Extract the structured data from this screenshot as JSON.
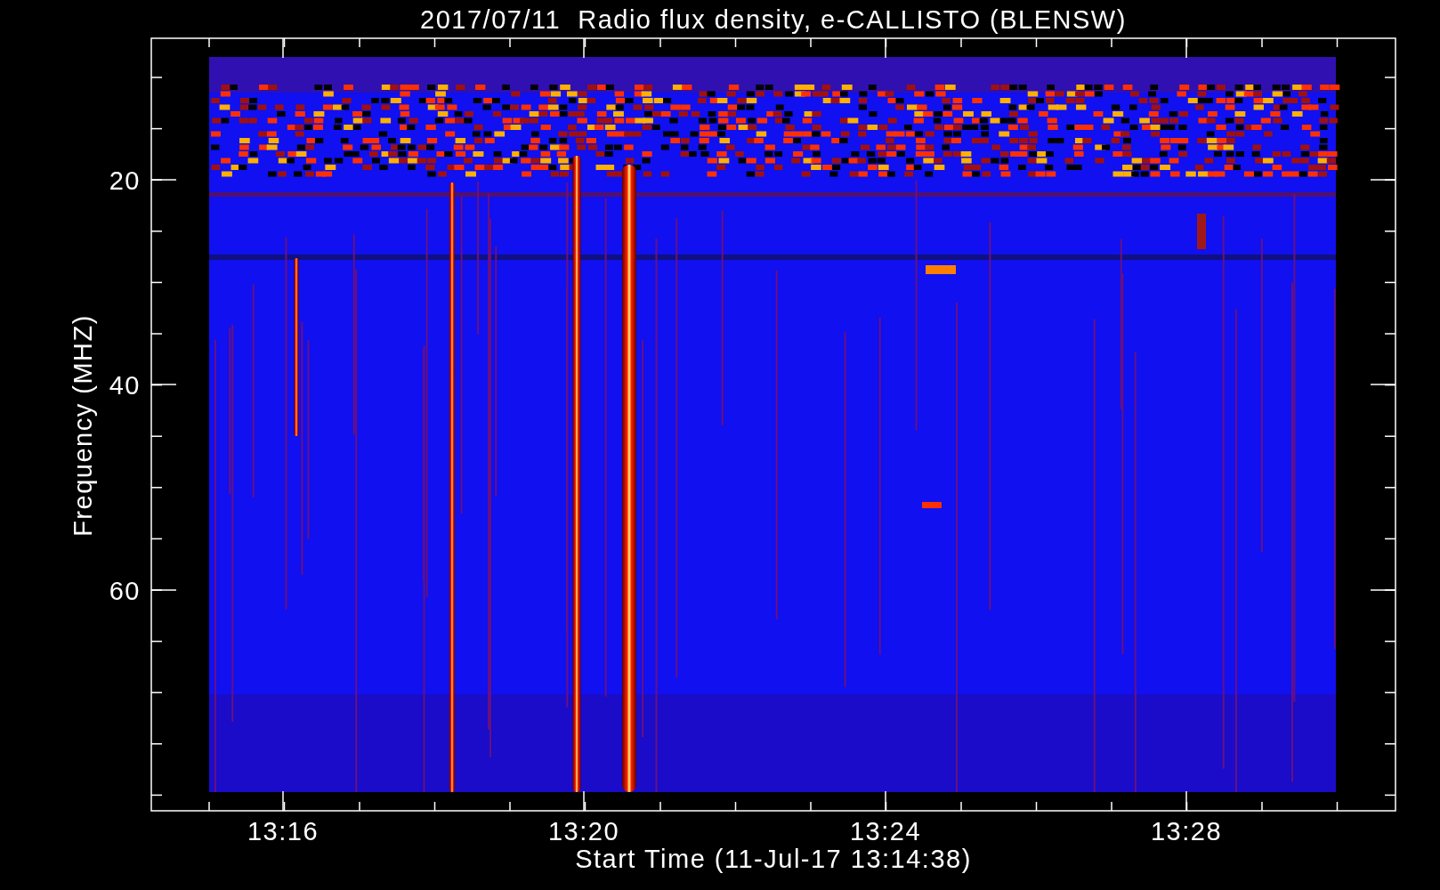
{
  "title": "2017/07/11  Radio flux density, e-CALLISTO (BLENSW)",
  "xlabel": "Start Time (11-Jul-17 13:14:38)",
  "ylabel": "Frequency (MHZ)",
  "xticks": [
    "13:16",
    "13:20",
    "13:24",
    "13:28"
  ],
  "yticks": [
    "20",
    "40",
    "60"
  ]
}
